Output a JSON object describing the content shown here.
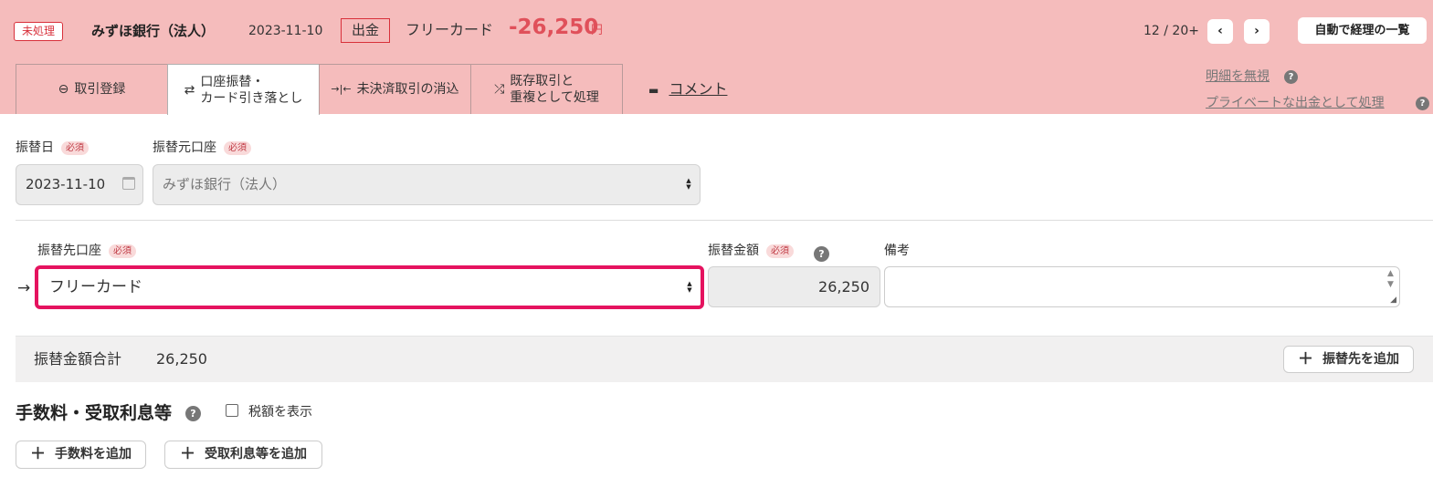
{
  "header": {
    "status_badge": "未処理",
    "bank_name": "みずほ銀行（法人）",
    "date": "2023-11-10",
    "type": "出金",
    "partner": "フリーカード",
    "amount": "-26,250",
    "currency": "円",
    "pager": "12 / 20+",
    "pager_prev": "‹",
    "pager_next": "›",
    "list_button": "自動で経理の一覧"
  },
  "tabs": [
    {
      "icon": "⊖",
      "icon_name": "minus-circle-icon",
      "label": "取引登録"
    },
    {
      "icon": "⇄",
      "icon_name": "transfer-arrows-icon",
      "label": "口座振替・\nカード引き落とし"
    },
    {
      "icon": "→|←",
      "icon_name": "settle-arrows-icon",
      "label": "未決済取引の消込"
    },
    {
      "icon": "⤮",
      "icon_name": "merge-arrows-icon",
      "label": "既存取引と\n重複として処理"
    }
  ],
  "comment_tab": {
    "icon": "▬",
    "label": "コメント"
  },
  "side_links": {
    "ignore": "明細を無視",
    "private": "プライベートな出金として処理",
    "help_icon": "?"
  },
  "form": {
    "required": "必須",
    "transfer_date_label": "振替日",
    "transfer_date_value": "2023-11-10",
    "source_account_label": "振替元口座",
    "source_account_value": "みずほ銀行（法人）",
    "dest_account_label": "振替先口座",
    "dest_account_value": "フリーカード",
    "amount_label": "振替金額",
    "amount_value": "26,250",
    "memo_label": "備考",
    "memo_value": "",
    "arrow": "→"
  },
  "total": {
    "label": "振替金額合計",
    "value": "26,250",
    "add_button": "振替先を追加",
    "plus": "＋"
  },
  "fees": {
    "title": "手数料・受取利息等",
    "tax_checkbox_label": "税額を表示",
    "tax_checked": false,
    "add_fee_button": "手数料を追加",
    "add_interest_button": "受取利息等を追加"
  },
  "colors": {
    "header_bg": "#f5bcbc",
    "accent_red": "#e0505a",
    "highlight": "#e5135f"
  }
}
